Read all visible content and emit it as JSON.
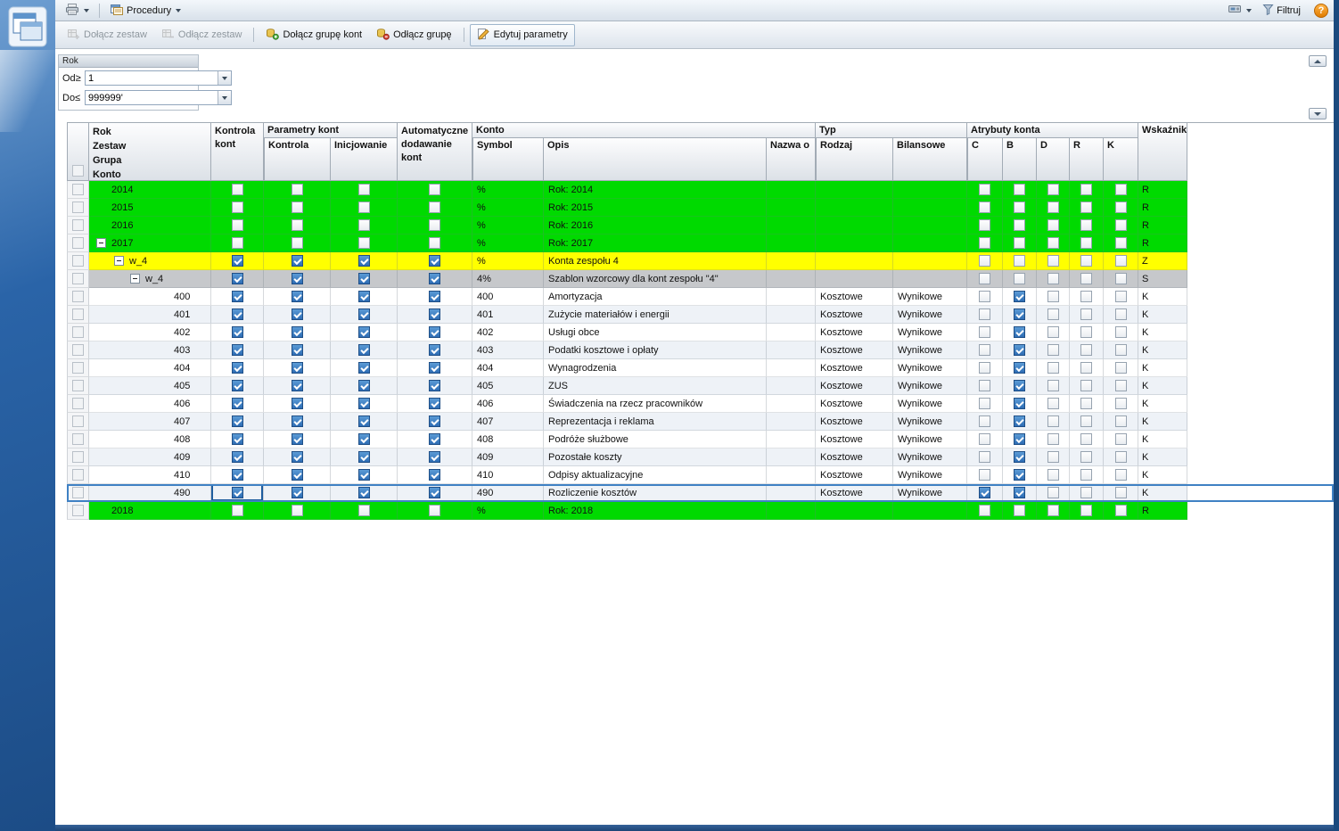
{
  "window": {
    "help_label": "?"
  },
  "top_toolbar": {
    "procedury_label": "Procedury",
    "filtruj_label": "Filtruj"
  },
  "action_toolbar": {
    "buttons": [
      {
        "label": "Dołącz zestaw",
        "icon": "attach-set-icon",
        "disabled": true
      },
      {
        "label": "Odłącz zestaw",
        "icon": "detach-set-icon",
        "disabled": true
      },
      {
        "label": "Dołącz grupę kont",
        "icon": "attach-account-group-icon",
        "disabled": false
      },
      {
        "label": "Odłącz grupę",
        "icon": "detach-group-icon",
        "disabled": false
      },
      {
        "label": "Edytuj parametry",
        "icon": "edit-parameters-icon",
        "disabled": false
      }
    ]
  },
  "filter_panel": {
    "group_title": "Rok",
    "from_label": "Od≥",
    "from_value": "1",
    "to_label": "Do≤",
    "to_value": "999999'"
  },
  "grid": {
    "colors": {
      "year_row": "#00da00",
      "set_row": "#ffff00",
      "template_row": "#c6c8cb",
      "selection_border": "#3f81c4",
      "checked_checkbox": "#2e6db4"
    },
    "headers": {
      "tree_lines": [
        "Rok",
        "Zestaw",
        "Grupa",
        "Konto"
      ],
      "kontrola_kont": "Kontrola kont",
      "parametry_group": "Parametry kont",
      "parametry_sub": [
        "Kontrola",
        "Inicjowanie"
      ],
      "auto_dodawanie": "Automatyczne dodawanie kont",
      "konto_group": "Konto",
      "konto_sub": [
        "Symbol",
        "Opis",
        "Nazwa o"
      ],
      "typ_group": "Typ",
      "typ_sub": [
        "Rodzaj",
        "Bilansowe"
      ],
      "atrybuty_group": "Atrybuty konta",
      "atrybuty_sub": [
        "C",
        "B",
        "D",
        "R",
        "K"
      ],
      "wskaznik": "Wskaźnik"
    },
    "rows": [
      {
        "type": "year",
        "level": 0,
        "expander": "",
        "label": "2014",
        "checks": [
          false,
          false,
          false,
          false
        ],
        "symbol": "%",
        "opis": "Rok: 2014",
        "nazwa": "",
        "rodzaj": "",
        "bilansowe": "",
        "attrs": [
          false,
          false,
          false,
          false,
          false
        ],
        "wskaznik": "R",
        "selected": false
      },
      {
        "type": "year",
        "level": 0,
        "expander": "",
        "label": "2015",
        "checks": [
          false,
          false,
          false,
          false
        ],
        "symbol": "%",
        "opis": "Rok: 2015",
        "nazwa": "",
        "rodzaj": "",
        "bilansowe": "",
        "attrs": [
          false,
          false,
          false,
          false,
          false
        ],
        "wskaznik": "R",
        "selected": false
      },
      {
        "type": "year",
        "level": 0,
        "expander": "",
        "label": "2016",
        "checks": [
          false,
          false,
          false,
          false
        ],
        "symbol": "%",
        "opis": "Rok: 2016",
        "nazwa": "",
        "rodzaj": "",
        "bilansowe": "",
        "attrs": [
          false,
          false,
          false,
          false,
          false
        ],
        "wskaznik": "R",
        "selected": false
      },
      {
        "type": "year",
        "level": 0,
        "expander": "-",
        "label": "2017",
        "checks": [
          false,
          false,
          false,
          false
        ],
        "symbol": "%",
        "opis": "Rok: 2017",
        "nazwa": "",
        "rodzaj": "",
        "bilansowe": "",
        "attrs": [
          false,
          false,
          false,
          false,
          false
        ],
        "wskaznik": "R",
        "selected": false
      },
      {
        "type": "set",
        "level": 1,
        "expander": "-",
        "label": "w_4",
        "checks": [
          true,
          true,
          true,
          true
        ],
        "symbol": "%",
        "opis": "Konta zespołu 4",
        "nazwa": "",
        "rodzaj": "",
        "bilansowe": "",
        "attrs": [
          false,
          false,
          false,
          false,
          false
        ],
        "wskaznik": "Z",
        "selected": false
      },
      {
        "type": "template",
        "level": 2,
        "expander": "-",
        "label": "w_4",
        "checks": [
          true,
          true,
          true,
          true
        ],
        "symbol": "4%",
        "opis": "Szablon wzorcowy dla kont zespołu \"4\"",
        "nazwa": "",
        "rodzaj": "",
        "bilansowe": "",
        "attrs": [
          false,
          false,
          false,
          false,
          false
        ],
        "wskaznik": "S",
        "selected": false
      },
      {
        "type": "account",
        "level": 3,
        "expander": "",
        "label": "400",
        "checks": [
          true,
          true,
          true,
          true
        ],
        "symbol": "400",
        "opis": "Amortyzacja",
        "nazwa": "",
        "rodzaj": "Kosztowe",
        "bilansowe": "Wynikowe",
        "attrs": [
          false,
          true,
          false,
          false,
          false
        ],
        "wskaznik": "K",
        "selected": false
      },
      {
        "type": "account",
        "level": 3,
        "expander": "",
        "label": "401",
        "checks": [
          true,
          true,
          true,
          true
        ],
        "symbol": "401",
        "opis": "Zużycie materiałów i energii",
        "nazwa": "",
        "rodzaj": "Kosztowe",
        "bilansowe": "Wynikowe",
        "attrs": [
          false,
          true,
          false,
          false,
          false
        ],
        "wskaznik": "K",
        "selected": false
      },
      {
        "type": "account",
        "level": 3,
        "expander": "",
        "label": "402",
        "checks": [
          true,
          true,
          true,
          true
        ],
        "symbol": "402",
        "opis": "Usługi obce",
        "nazwa": "",
        "rodzaj": "Kosztowe",
        "bilansowe": "Wynikowe",
        "attrs": [
          false,
          true,
          false,
          false,
          false
        ],
        "wskaznik": "K",
        "selected": false
      },
      {
        "type": "account",
        "level": 3,
        "expander": "",
        "label": "403",
        "checks": [
          true,
          true,
          true,
          true
        ],
        "symbol": "403",
        "opis": "Podatki kosztowe i opłaty",
        "nazwa": "",
        "rodzaj": "Kosztowe",
        "bilansowe": "Wynikowe",
        "attrs": [
          false,
          true,
          false,
          false,
          false
        ],
        "wskaznik": "K",
        "selected": false
      },
      {
        "type": "account",
        "level": 3,
        "expander": "",
        "label": "404",
        "checks": [
          true,
          true,
          true,
          true
        ],
        "symbol": "404",
        "opis": "Wynagrodzenia",
        "nazwa": "",
        "rodzaj": "Kosztowe",
        "bilansowe": "Wynikowe",
        "attrs": [
          false,
          true,
          false,
          false,
          false
        ],
        "wskaznik": "K",
        "selected": false
      },
      {
        "type": "account",
        "level": 3,
        "expander": "",
        "label": "405",
        "checks": [
          true,
          true,
          true,
          true
        ],
        "symbol": "405",
        "opis": "ZUS",
        "nazwa": "",
        "rodzaj": "Kosztowe",
        "bilansowe": "Wynikowe",
        "attrs": [
          false,
          true,
          false,
          false,
          false
        ],
        "wskaznik": "K",
        "selected": false
      },
      {
        "type": "account",
        "level": 3,
        "expander": "",
        "label": "406",
        "checks": [
          true,
          true,
          true,
          true
        ],
        "symbol": "406",
        "opis": "Świadczenia na rzecz pracowników",
        "nazwa": "",
        "rodzaj": "Kosztowe",
        "bilansowe": "Wynikowe",
        "attrs": [
          false,
          true,
          false,
          false,
          false
        ],
        "wskaznik": "K",
        "selected": false
      },
      {
        "type": "account",
        "level": 3,
        "expander": "",
        "label": "407",
        "checks": [
          true,
          true,
          true,
          true
        ],
        "symbol": "407",
        "opis": "Reprezentacja i reklama",
        "nazwa": "",
        "rodzaj": "Kosztowe",
        "bilansowe": "Wynikowe",
        "attrs": [
          false,
          true,
          false,
          false,
          false
        ],
        "wskaznik": "K",
        "selected": false
      },
      {
        "type": "account",
        "level": 3,
        "expander": "",
        "label": "408",
        "checks": [
          true,
          true,
          true,
          true
        ],
        "symbol": "408",
        "opis": "Podróże służbowe",
        "nazwa": "",
        "rodzaj": "Kosztowe",
        "bilansowe": "Wynikowe",
        "attrs": [
          false,
          true,
          false,
          false,
          false
        ],
        "wskaznik": "K",
        "selected": false
      },
      {
        "type": "account",
        "level": 3,
        "expander": "",
        "label": "409",
        "checks": [
          true,
          true,
          true,
          true
        ],
        "symbol": "409",
        "opis": "Pozostałe koszty",
        "nazwa": "",
        "rodzaj": "Kosztowe",
        "bilansowe": "Wynikowe",
        "attrs": [
          false,
          true,
          false,
          false,
          false
        ],
        "wskaznik": "K",
        "selected": false
      },
      {
        "type": "account",
        "level": 3,
        "expander": "",
        "label": "410",
        "checks": [
          true,
          true,
          true,
          true
        ],
        "symbol": "410",
        "opis": "Odpisy aktualizacyjne",
        "nazwa": "",
        "rodzaj": "Kosztowe",
        "bilansowe": "Wynikowe",
        "attrs": [
          false,
          true,
          false,
          false,
          false
        ],
        "wskaznik": "K",
        "selected": false
      },
      {
        "type": "account",
        "level": 3,
        "expander": "",
        "label": "490",
        "checks": [
          true,
          true,
          true,
          true
        ],
        "symbol": "490",
        "opis": "Rozliczenie kosztów",
        "nazwa": "",
        "rodzaj": "Kosztowe",
        "bilansowe": "Wynikowe",
        "attrs": [
          true,
          true,
          false,
          false,
          false
        ],
        "wskaznik": "K",
        "selected": true
      },
      {
        "type": "year",
        "level": 0,
        "expander": "",
        "label": "2018",
        "checks": [
          false,
          false,
          false,
          false
        ],
        "symbol": "%",
        "opis": "Rok: 2018",
        "nazwa": "",
        "rodzaj": "",
        "bilansowe": "",
        "attrs": [
          false,
          false,
          false,
          false,
          false
        ],
        "wskaznik": "R",
        "selected": false
      }
    ]
  }
}
